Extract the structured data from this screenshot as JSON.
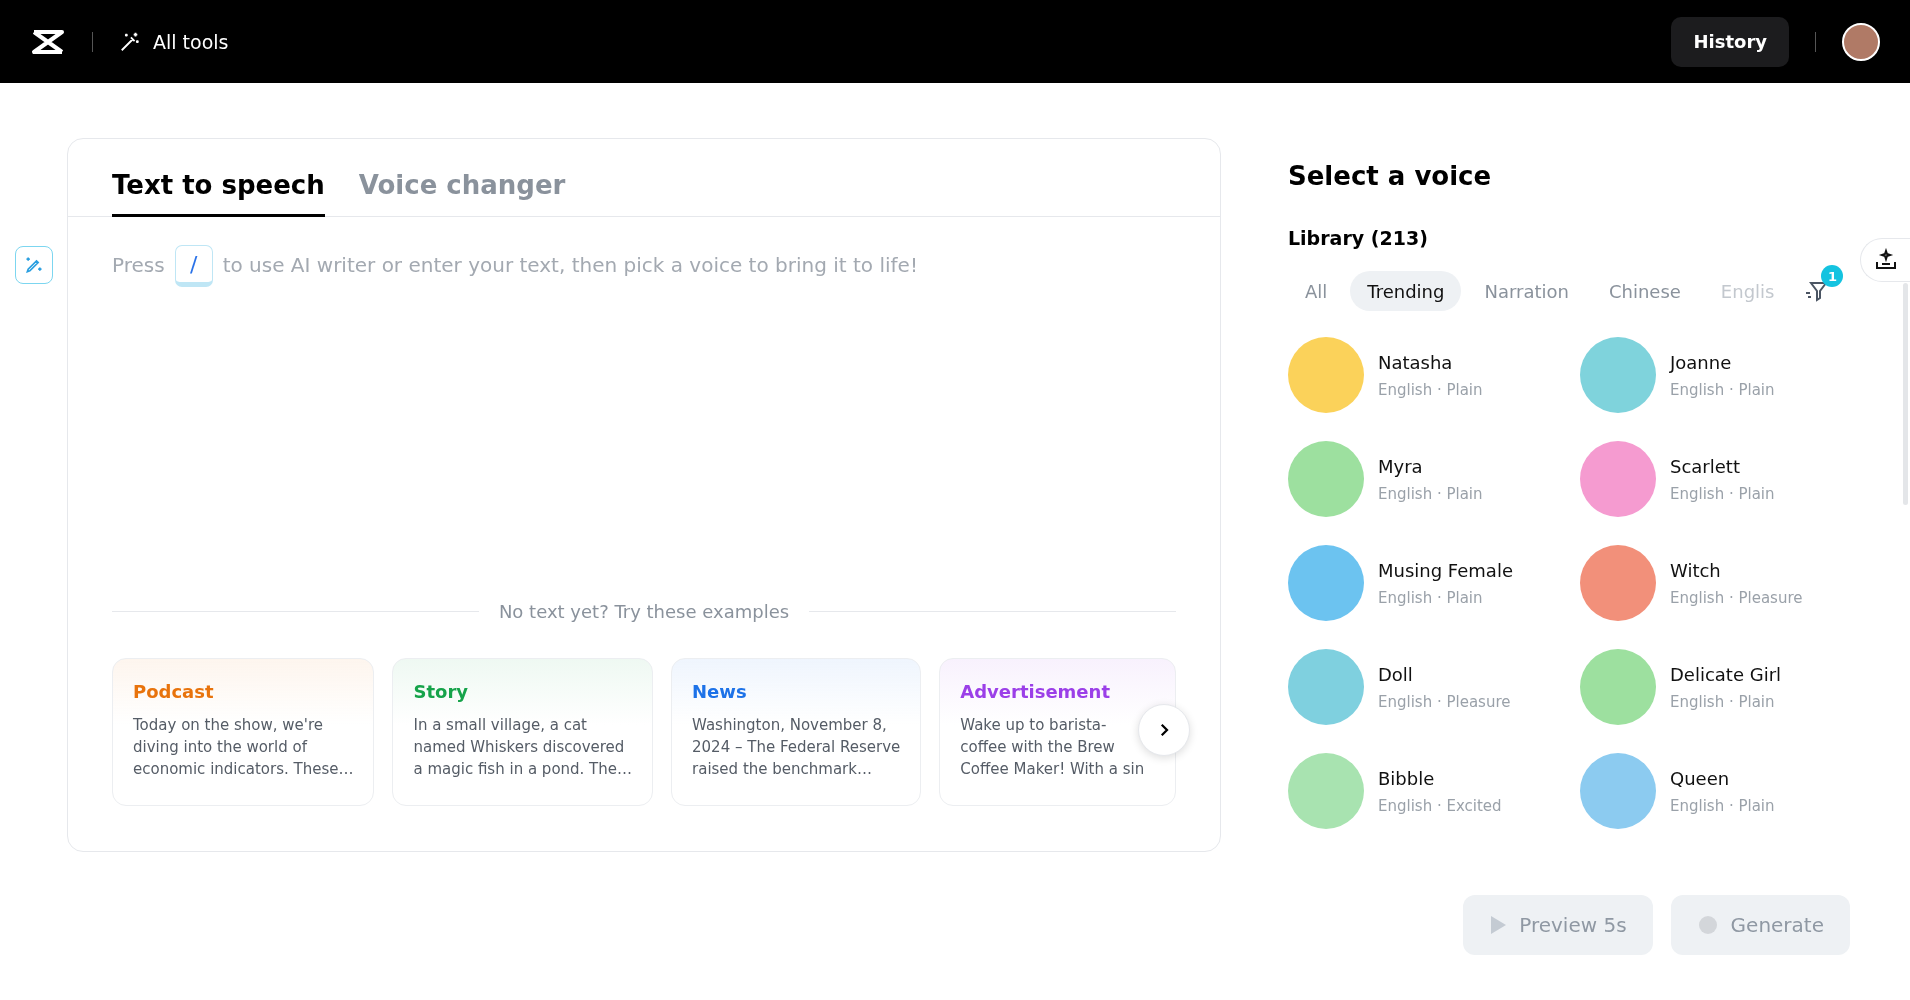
{
  "topbar": {
    "all_tools": "All tools",
    "history": "History"
  },
  "tabs": [
    {
      "label": "Text to speech",
      "selected": true
    },
    {
      "label": "Voice changer",
      "selected": false
    }
  ],
  "editor": {
    "prompt_before": "Press",
    "key": "/",
    "prompt_after": "to use AI writer or enter your text, then pick a voice to bring it to life!",
    "examples_heading": "No text yet? Try these examples"
  },
  "examples": [
    {
      "title": "Podcast",
      "color": "#e8730c",
      "lines": [
        "Today on the show, we're",
        "diving into the world of",
        "economic indicators. These…"
      ]
    },
    {
      "title": "Story",
      "color": "#16a34a",
      "lines": [
        "In a small village, a cat",
        "named Whiskers discovered",
        "a magic fish in a pond. The…"
      ]
    },
    {
      "title": "News",
      "color": "#1d72e8",
      "lines": [
        "Washington, November 8,",
        "2024 – The Federal Reserve",
        "raised the benchmark…"
      ]
    },
    {
      "title": "Advertisement",
      "color": "#9b3fe8",
      "lines": [
        "Wake up to barista-",
        "coffee with the Brew",
        "Coffee Maker! With a sin"
      ]
    }
  ],
  "voice_panel": {
    "title": "Select a voice",
    "library": "Library (213)",
    "filter_count": "1"
  },
  "filters": [
    {
      "label": "All",
      "selected": false
    },
    {
      "label": "Trending",
      "selected": true
    },
    {
      "label": "Narration",
      "selected": false
    },
    {
      "label": "Chinese",
      "selected": false
    },
    {
      "label": "Englis",
      "selected": false
    }
  ],
  "voices": [
    {
      "name": "Natasha",
      "meta": "English · Plain",
      "color": "#fbd25a"
    },
    {
      "name": "Joanne",
      "meta": "English · Plain",
      "color": "#7fd3dc"
    },
    {
      "name": "Myra",
      "meta": "English · Plain",
      "color": "#9de09f"
    },
    {
      "name": "Scarlett",
      "meta": "English · Plain",
      "color": "#f59bd0"
    },
    {
      "name": "Musing Female",
      "meta": "English · Plain",
      "color": "#6cc3f0"
    },
    {
      "name": "Witch",
      "meta": "English · Pleasure",
      "color": "#f2907a"
    },
    {
      "name": "Doll",
      "meta": "English · Pleasure",
      "color": "#7fd0df"
    },
    {
      "name": "Delicate Girl",
      "meta": "English · Plain",
      "color": "#9de09f"
    },
    {
      "name": "Bibble",
      "meta": "English · Excited",
      "color": "#a8e3b0"
    },
    {
      "name": "Queen",
      "meta": "English · Plain",
      "color": "#8ccbf0"
    }
  ],
  "actions": {
    "preview": "Preview 5s",
    "generate": "Generate",
    "disabled": true
  }
}
